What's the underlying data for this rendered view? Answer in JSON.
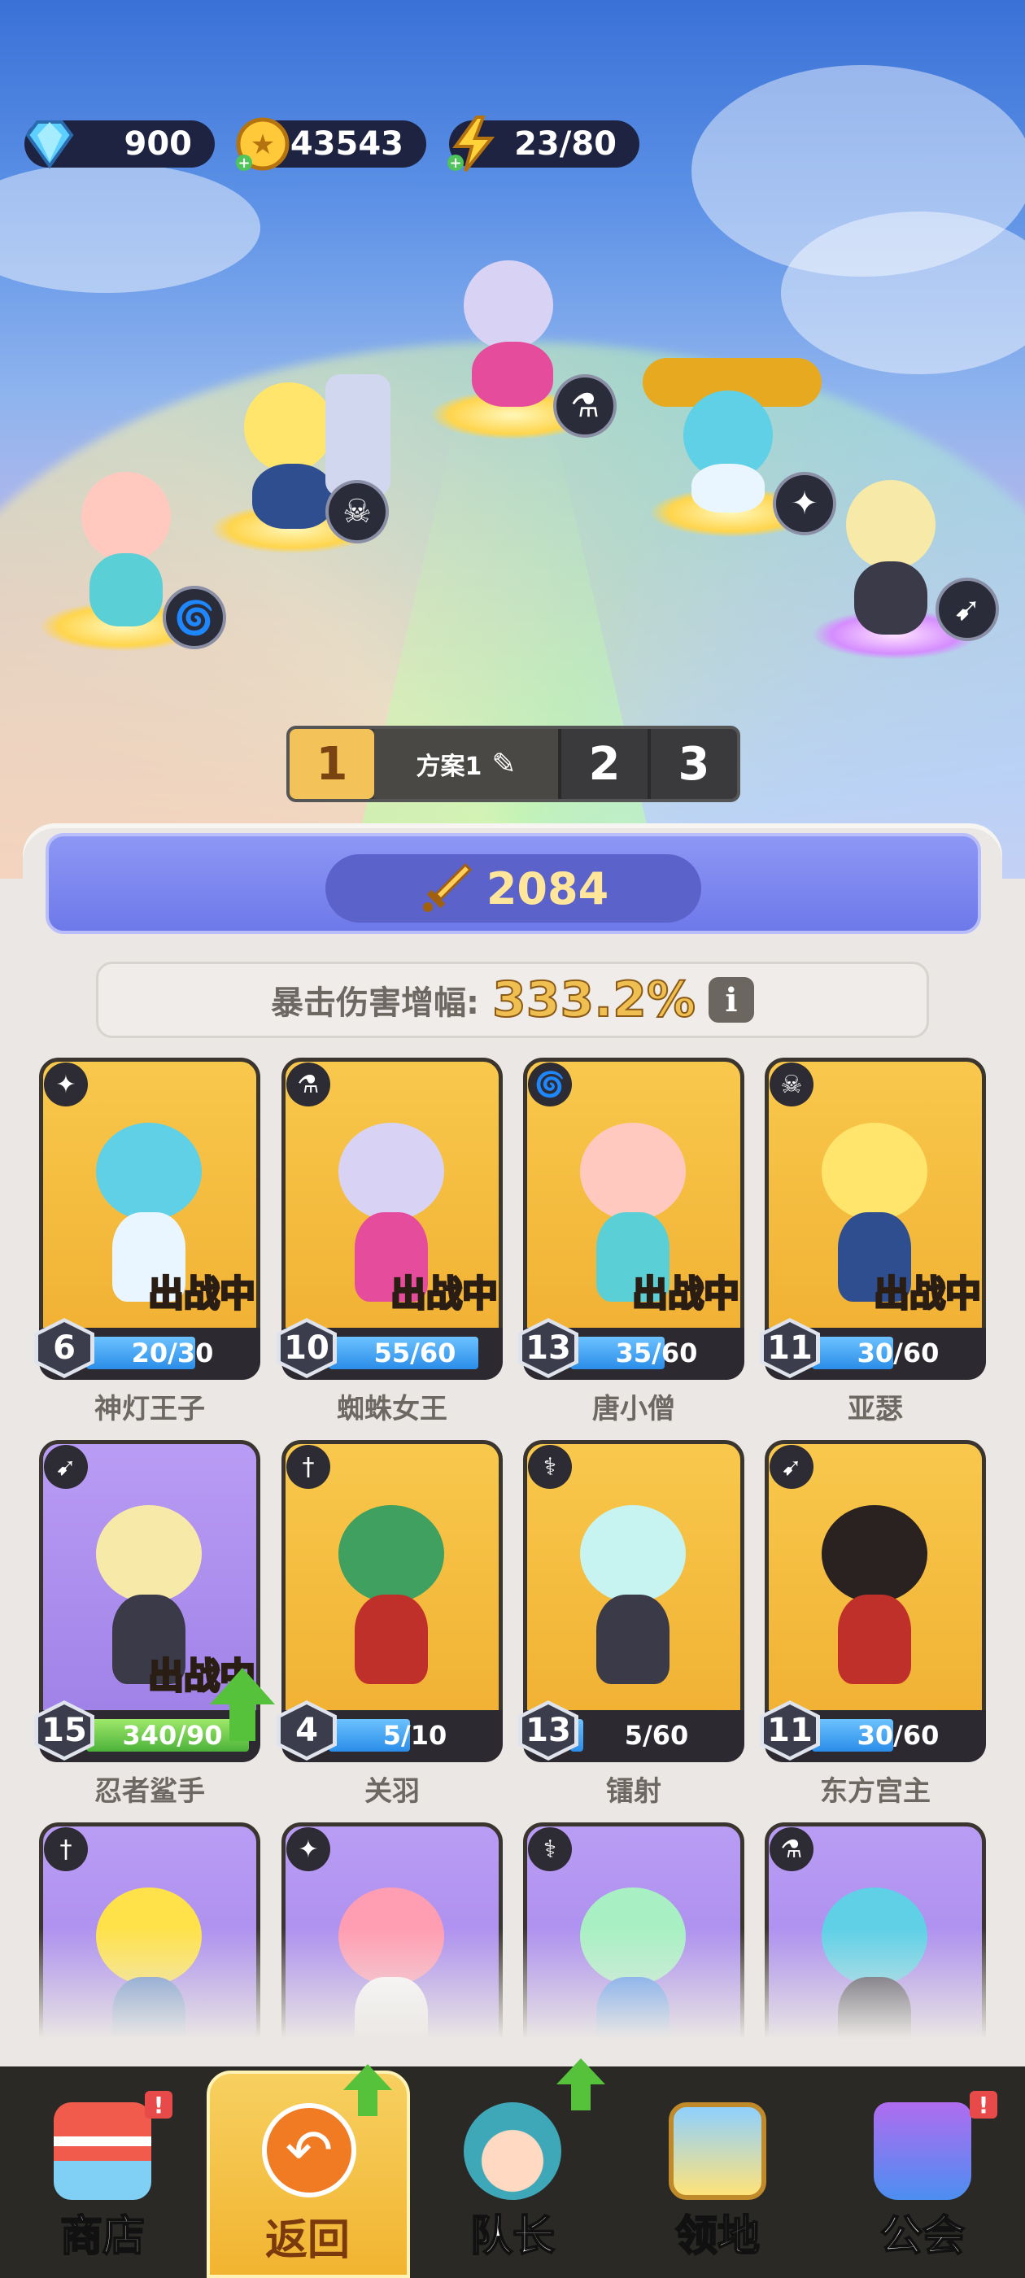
{
  "resources": {
    "diamonds": "900",
    "gold": "43543",
    "energy": "23/80"
  },
  "lineup": {
    "tabs": [
      "1",
      "方案1",
      "2",
      "3"
    ],
    "selected_tab": "1"
  },
  "power": "2084",
  "crit": {
    "label": "暴击伤害增幅:",
    "value": "333.2%",
    "info_icon": "info-icon"
  },
  "heroes": [
    {
      "name": "神灯王子",
      "level": "6",
      "progress": "20/30",
      "fill": 0.67,
      "deployed": true,
      "class_icon": "wings-icon",
      "frame": "gold"
    },
    {
      "name": "蜘蛛女王",
      "level": "10",
      "progress": "55/60",
      "fill": 0.92,
      "deployed": true,
      "class_icon": "potion-icon",
      "frame": "gold"
    },
    {
      "name": "唐小僧",
      "level": "13",
      "progress": "35/60",
      "fill": 0.58,
      "deployed": true,
      "class_icon": "vortex-icon",
      "frame": "gold"
    },
    {
      "name": "亚瑟",
      "level": "11",
      "progress": "30/60",
      "fill": 0.5,
      "deployed": true,
      "class_icon": "horns-icon",
      "frame": "gold"
    },
    {
      "name": "忍者鲨手",
      "level": "15",
      "progress": "340/90",
      "fill": 1.0,
      "deployed": true,
      "class_icon": "bow-icon",
      "frame": "purple",
      "upgrade": true
    },
    {
      "name": "关羽",
      "level": "4",
      "progress": "5/10",
      "fill": 0.5,
      "deployed": false,
      "class_icon": "sword-icon",
      "frame": "gold"
    },
    {
      "name": "镭射",
      "level": "13",
      "progress": "5/60",
      "fill": 0.08,
      "deployed": false,
      "class_icon": "staff-icon",
      "frame": "gold"
    },
    {
      "name": "东方宫主",
      "level": "11",
      "progress": "30/60",
      "fill": 0.5,
      "deployed": false,
      "class_icon": "bow-icon",
      "frame": "gold"
    },
    {
      "name": "",
      "level": "",
      "progress": "",
      "fill": 0,
      "deployed": false,
      "class_icon": "sword-icon",
      "frame": "purple"
    },
    {
      "name": "",
      "level": "",
      "progress": "",
      "fill": 0,
      "deployed": false,
      "class_icon": "wings-icon",
      "frame": "purple"
    },
    {
      "name": "",
      "level": "",
      "progress": "",
      "fill": 0,
      "deployed": false,
      "class_icon": "staff-icon",
      "frame": "purple"
    },
    {
      "name": "",
      "level": "",
      "progress": "",
      "fill": 0,
      "deployed": false,
      "class_icon": "potion-icon",
      "frame": "purple"
    }
  ],
  "deployed_label": "出战中",
  "nav": [
    {
      "label": "商店",
      "icon": "shop-icon",
      "alert": "!"
    },
    {
      "label": "返回",
      "icon": "back-arrow-icon",
      "active": true,
      "upgrade": true
    },
    {
      "label": "队长",
      "icon": "captain-avatar-icon",
      "upgrade": true
    },
    {
      "label": "领地",
      "icon": "territory-icon"
    },
    {
      "label": "公会",
      "icon": "guild-icon",
      "alert": "!"
    }
  ]
}
